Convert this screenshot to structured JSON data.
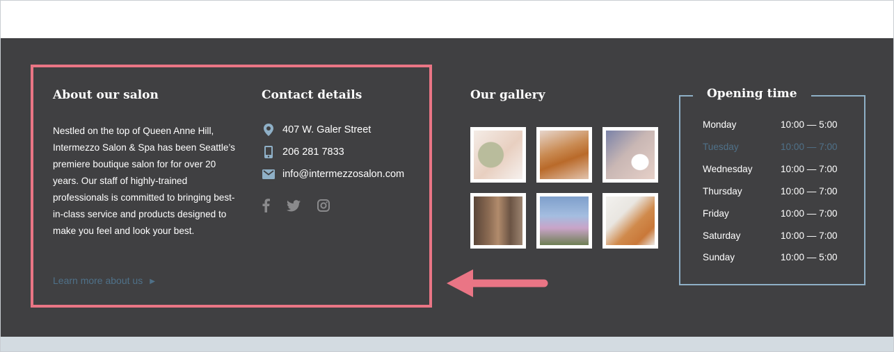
{
  "about": {
    "heading": "About our salon",
    "text": "Nestled on the top of Queen Anne Hill, Intermezzo Salon & Spa has been Seattle’s premiere boutique salon for for over 20 years. Our staff of highly-trained professionals is committed to bringing best-in-class service and products designed to make you feel and look your best.",
    "learn_more": "Learn more about us"
  },
  "contact": {
    "heading": "Contact details",
    "address": "407 W. Galer Street",
    "phone": "206 281 7833",
    "email": "info@intermezzosalon.com",
    "social": [
      "facebook-icon",
      "twitter-icon",
      "instagram-icon"
    ]
  },
  "gallery": {
    "heading": "Our gallery",
    "images": [
      "face-mask-photo",
      "waxing-photo",
      "eyelash-photo",
      "hair-photo",
      "space-needle-photo",
      "wax-application-photo"
    ]
  },
  "hours": {
    "heading": "Opening time",
    "rows": [
      {
        "day": "Monday",
        "time": "10:00 — 5:00"
      },
      {
        "day": "Tuesday",
        "time": "10:00 — 7:00"
      },
      {
        "day": "Wednesday",
        "time": "10:00 — 7:00"
      },
      {
        "day": "Thursday",
        "time": "10:00 — 7:00"
      },
      {
        "day": "Friday",
        "time": "10:00 — 7:00"
      },
      {
        "day": "Saturday",
        "time": "10:00 — 7:00"
      },
      {
        "day": "Sunday",
        "time": "10:00 — 5:00"
      }
    ],
    "highlighted_day": "Tuesday"
  },
  "colors": {
    "footer_bg": "#404042",
    "accent_blue": "#8fb0c7",
    "link_blue": "#4f7189",
    "highlight_pink": "#ea7585"
  }
}
